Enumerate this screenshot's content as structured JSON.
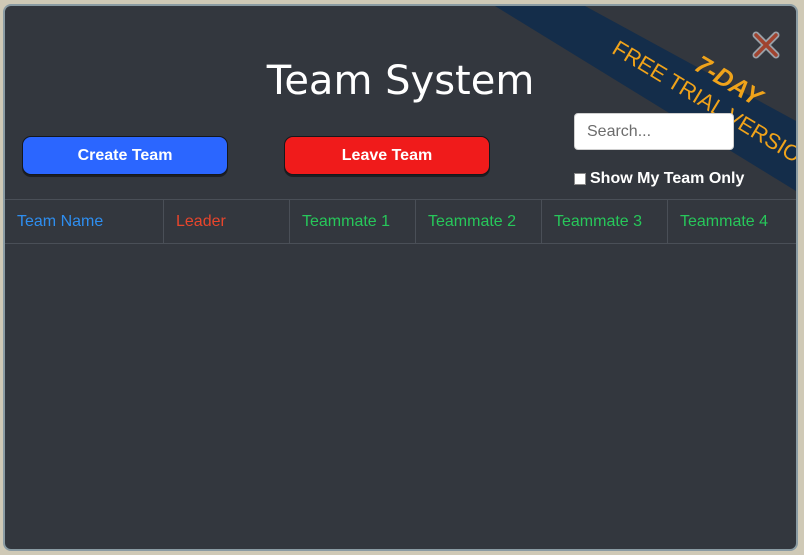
{
  "title": "Team System",
  "buttons": {
    "create": "Create Team",
    "leave": "Leave Team"
  },
  "search": {
    "placeholder": "Search...",
    "value": ""
  },
  "filter": {
    "label": "Show My Team Only",
    "checked": false
  },
  "ribbon": {
    "line1": "7-DAY",
    "line2": "FREE TRIAL VERSION"
  },
  "table": {
    "columns": [
      {
        "label": "Team Name",
        "color": "#2e8ef0"
      },
      {
        "label": "Leader",
        "color": "#e8452c"
      },
      {
        "label": "Teammate 1",
        "color": "#27c75a"
      },
      {
        "label": "Teammate 2",
        "color": "#27c75a"
      },
      {
        "label": "Teammate 3",
        "color": "#27c75a"
      },
      {
        "label": "Teammate 4",
        "color": "#27c75a"
      }
    ],
    "rows": []
  },
  "colors": {
    "panel": "#33373e",
    "create": "#2b66ff",
    "leave": "#f01b1b",
    "ribbon": "#142d4a",
    "ribbonText": "#f0a31a"
  }
}
